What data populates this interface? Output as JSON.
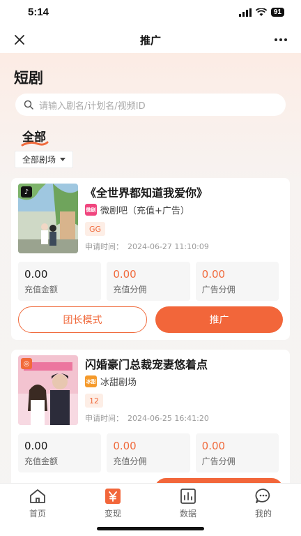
{
  "status": {
    "time": "5:14",
    "battery": "91"
  },
  "nav": {
    "title": "推广"
  },
  "page": {
    "title": "短剧"
  },
  "search": {
    "placeholder": "请输入剧名/计划名/视频ID"
  },
  "tabs": {
    "active": "全部"
  },
  "filter": {
    "label": "全部剧场"
  },
  "cards": [
    {
      "title": "《全世界都知道我爱你》",
      "platform": "微剧吧（充值+广告）",
      "tag": "GG",
      "apply_label": "申请时间：",
      "apply_time": "2024-06-27 11:10:09",
      "stats": [
        {
          "value": "0.00",
          "label": "充值金额"
        },
        {
          "value": "0.00",
          "label": "充值分佣"
        },
        {
          "value": "0.00",
          "label": "广告分佣"
        }
      ],
      "btn_secondary": "团长模式",
      "btn_primary": "推广"
    },
    {
      "title": "闪婚豪门总裁宠妻悠着点",
      "platform": "冰甜剧场",
      "tag": "12",
      "apply_label": "申请时间：",
      "apply_time": "2024-06-25 16:41:20",
      "stats": [
        {
          "value": "0.00",
          "label": "充值金额"
        },
        {
          "value": "0.00",
          "label": "充值分佣"
        },
        {
          "value": "0.00",
          "label": "广告分佣"
        }
      ]
    }
  ],
  "tabbar": [
    {
      "label": "首页",
      "icon": "home-icon"
    },
    {
      "label": "变现",
      "icon": "yen-icon"
    },
    {
      "label": "数据",
      "icon": "chart-icon"
    },
    {
      "label": "我的",
      "icon": "chat-icon"
    }
  ],
  "colors": {
    "accent": "#f06a3c",
    "accent_fill": "#f2663a"
  }
}
